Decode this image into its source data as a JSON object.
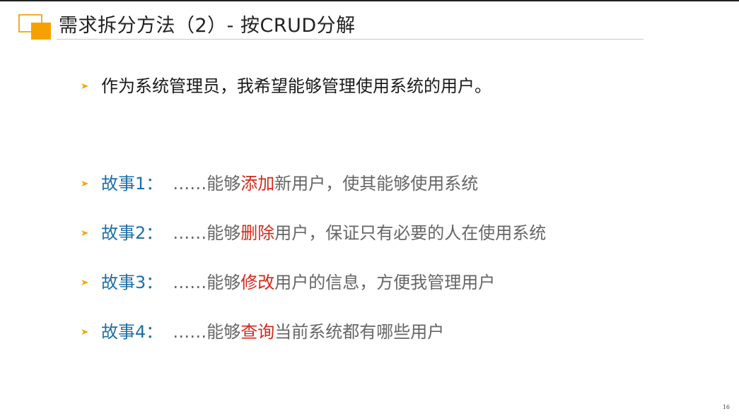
{
  "title": "需求拆分方法（2）- 按CRUD分解",
  "intro": "作为系统管理员，我希望能够管理使用系统的用户。",
  "stories": [
    {
      "label": "故事1：",
      "prefix": "……能够",
      "highlight": "添加",
      "suffix": "新用户，使其能够使用系统"
    },
    {
      "label": "故事2：",
      "prefix": "……能够",
      "highlight": "删除",
      "suffix": "用户，保证只有必要的人在使用系统"
    },
    {
      "label": "故事3：",
      "prefix": "……能够",
      "highlight": "修改",
      "suffix": "用户的信息，方便我管理用户"
    },
    {
      "label": "故事4：",
      "prefix": "……能够",
      "highlight": "查询",
      "suffix": "当前系统都有哪些用户"
    }
  ],
  "page_number": "16",
  "colors": {
    "accent": "#f5a200",
    "story_label": "#1b6fa8",
    "highlight": "#d42a1a",
    "body_text": "#666666"
  },
  "icons": {
    "logo": "orange-square-logo-icon",
    "bullet": "arrow-bullet-icon"
  }
}
